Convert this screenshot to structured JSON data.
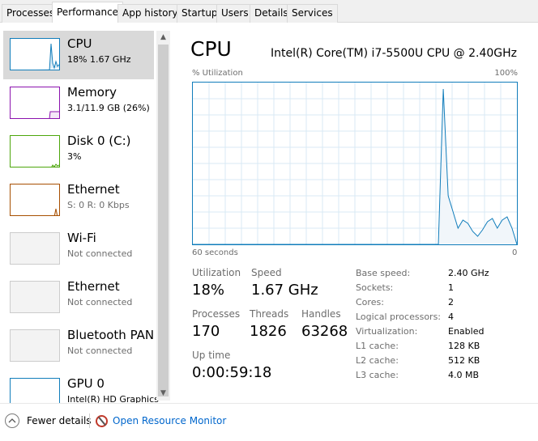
{
  "tabs": [
    {
      "label": "Processes"
    },
    {
      "label": "Performance"
    },
    {
      "label": "App history"
    },
    {
      "label": "Startup"
    },
    {
      "label": "Users"
    },
    {
      "label": "Details"
    },
    {
      "label": "Services"
    }
  ],
  "active_tab": "Performance",
  "sidebar": {
    "items": [
      {
        "title": "CPU",
        "sub": "18%  1.67 GHz",
        "color": "#117dbb"
      },
      {
        "title": "Memory",
        "sub": "3.1/11.9 GB (26%)",
        "color": "#8b12ae"
      },
      {
        "title": "Disk 0 (C:)",
        "sub": "3%",
        "color": "#4da60c"
      },
      {
        "title": "Ethernet",
        "sub": "S: 0  R: 0 Kbps",
        "color": "#a74f01"
      },
      {
        "title": "Wi-Fi",
        "sub": "Not connected",
        "color": "#cccccc"
      },
      {
        "title": "Ethernet",
        "sub": "Not connected",
        "color": "#cccccc"
      },
      {
        "title": "Bluetooth PAN",
        "sub": "Not connected",
        "color": "#cccccc"
      },
      {
        "title": "GPU 0",
        "sub": "Intel(R) HD Graphics",
        "color": "#117dbb"
      }
    ]
  },
  "main": {
    "title": "CPU",
    "model": "Intel(R) Core(TM) i7-5500U CPU @ 2.40GHz",
    "graph_label_left": "% Utilization",
    "graph_label_right": "100%",
    "graph_time_left": "60 seconds",
    "graph_time_right": "0",
    "stats": {
      "utilization_label": "Utilization",
      "utilization_value": "18%",
      "speed_label": "Speed",
      "speed_value": "1.67 GHz",
      "processes_label": "Processes",
      "processes_value": "170",
      "threads_label": "Threads",
      "threads_value": "1826",
      "handles_label": "Handles",
      "handles_value": "63268",
      "uptime_label": "Up time",
      "uptime_value": "0:00:59:18"
    },
    "specs": [
      {
        "label": "Base speed:",
        "value": "2.40 GHz"
      },
      {
        "label": "Sockets:",
        "value": "1"
      },
      {
        "label": "Cores:",
        "value": "2"
      },
      {
        "label": "Logical processors:",
        "value": "4"
      },
      {
        "label": "Virtualization:",
        "value": "Enabled"
      },
      {
        "label": "L1 cache:",
        "value": "128 KB"
      },
      {
        "label": "L2 cache:",
        "value": "512 KB"
      },
      {
        "label": "L3 cache:",
        "value": "4.0 MB"
      }
    ],
    "cpu_history": [
      0,
      0,
      0,
      0,
      0,
      0,
      0,
      0,
      0,
      0,
      0,
      0,
      0,
      0,
      0,
      0,
      0,
      0,
      0,
      0,
      0,
      0,
      0,
      0,
      0,
      0,
      0,
      0,
      0,
      0,
      0,
      0,
      0,
      0,
      0,
      0,
      0,
      0,
      0,
      0,
      0,
      0,
      0,
      0,
      0,
      0,
      0,
      0,
      0,
      0,
      0,
      96,
      30,
      20,
      10,
      15,
      13,
      8,
      5,
      9,
      14,
      16,
      10,
      15,
      17,
      10,
      0
    ]
  },
  "footer": {
    "fewer_details": "Fewer details",
    "open_resource_monitor": "Open Resource Monitor"
  },
  "colors": {
    "cpu": "#117dbb",
    "memory": "#8b12ae",
    "disk": "#4da60c",
    "ethernet": "#a74f01",
    "link": "#0066cc"
  }
}
